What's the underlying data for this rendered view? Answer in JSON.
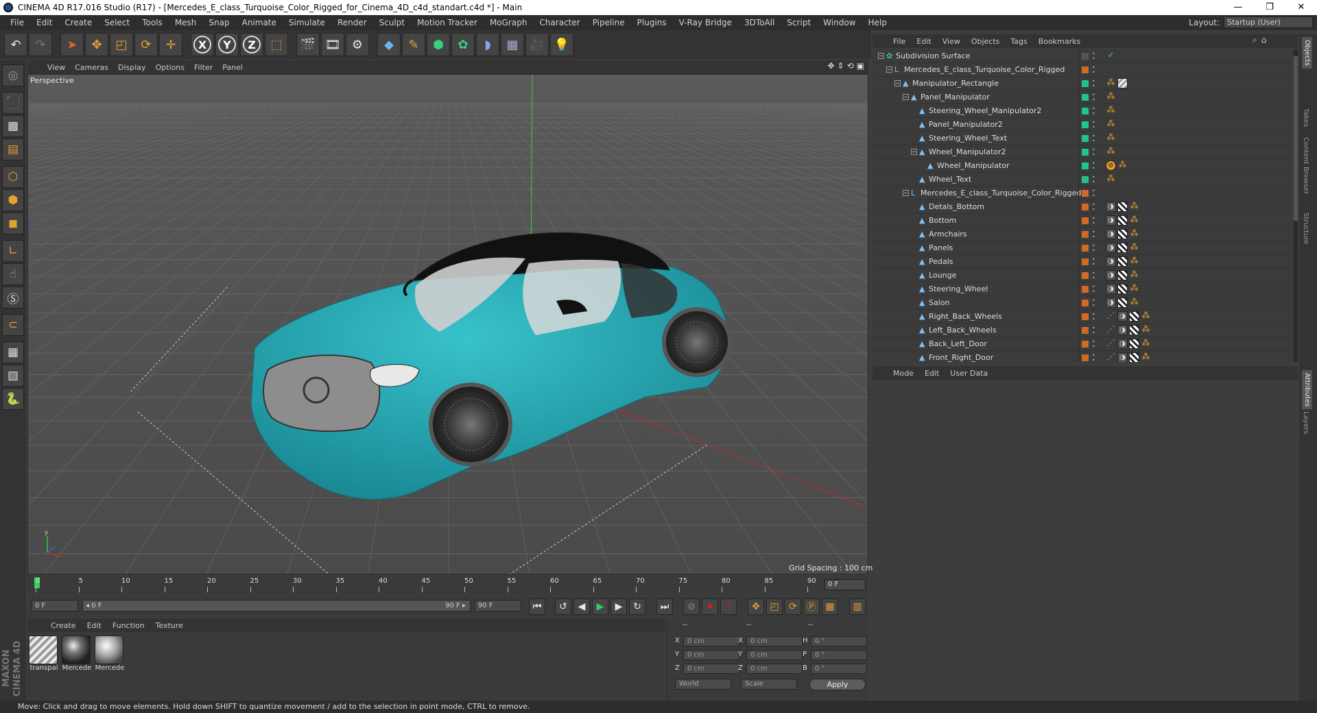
{
  "window": {
    "title": "CINEMA 4D R17.016 Studio (R17) - [Mercedes_E_class_Turquoise_Color_Rigged_for_Cinema_4D_c4d_standart.c4d *] - Main",
    "controls": [
      "—",
      "❐",
      "✕"
    ]
  },
  "menu": [
    "File",
    "Edit",
    "Create",
    "Select",
    "Tools",
    "Mesh",
    "Snap",
    "Animate",
    "Simulate",
    "Render",
    "Sculpt",
    "Motion Tracker",
    "MoGraph",
    "Character",
    "Pipeline",
    "Plugins",
    "V-Ray Bridge",
    "3DToAll",
    "Script",
    "Window",
    "Help"
  ],
  "layout": {
    "label": "Layout:",
    "value": "Startup (User)"
  },
  "viewport": {
    "menu": [
      "View",
      "Cameras",
      "Display",
      "Options",
      "Filter",
      "Panel"
    ],
    "label": "Perspective",
    "grid_spacing": "Grid Spacing : 100 cm"
  },
  "timeline": {
    "ticks": [
      "0",
      "5",
      "10",
      "15",
      "20",
      "25",
      "30",
      "35",
      "40",
      "45",
      "50",
      "55",
      "60",
      "65",
      "70",
      "75",
      "80",
      "85",
      "90"
    ],
    "frame_end_box": "0 F",
    "start_field": "0 F",
    "range_left": "◂ 0 F",
    "range_right": "90 F ▸",
    "end_field": "90 F"
  },
  "material_manager": {
    "menu": [
      "Create",
      "Edit",
      "Function",
      "Texture"
    ],
    "materials": [
      {
        "name": "transpai"
      },
      {
        "name": "Mercede"
      },
      {
        "name": "Mercede"
      }
    ]
  },
  "coordinates": {
    "headers": [
      "--",
      "--",
      "--"
    ],
    "rows": [
      {
        "a_label": "X",
        "a_value": "0 cm",
        "b_label": "X",
        "b_value": "0 cm",
        "c_label": "H",
        "c_value": "0 °"
      },
      {
        "a_label": "Y",
        "a_value": "0 cm",
        "b_label": "Y",
        "b_value": "0 cm",
        "c_label": "P",
        "c_value": "0 °"
      },
      {
        "a_label": "Z",
        "a_value": "0 cm",
        "b_label": "Z",
        "b_value": "0 cm",
        "c_label": "B",
        "c_value": "0 °"
      }
    ],
    "space": "World",
    "mode": "Scale",
    "apply": "Apply"
  },
  "object_manager": {
    "menu": [
      "File",
      "Edit",
      "View",
      "Objects",
      "Tags",
      "Bookmarks"
    ],
    "rows": [
      {
        "name": "Subdivision Surface",
        "depth": 0,
        "icon": "✿",
        "layer": "#555555",
        "tags": "check"
      },
      {
        "name": "Mercedes_E_class_Turquoise_Color_Rigged",
        "depth": 1,
        "icon": "L0",
        "layer": "#d06a2a",
        "tags": ""
      },
      {
        "name": "Manipulator_Rectangle",
        "depth": 2,
        "icon": "▲",
        "layer": "#22c48a",
        "tags": "dot-wt"
      },
      {
        "name": "Panel_Manipulator",
        "depth": 3,
        "icon": "▲",
        "layer": "#22c48a",
        "tags": "dot"
      },
      {
        "name": "Steering_Wheel_Manipulator2",
        "depth": 4,
        "icon": "▲",
        "layer": "#22c48a",
        "tags": "dot"
      },
      {
        "name": "Panel_Manipulator2",
        "depth": 4,
        "icon": "▲",
        "layer": "#22c48a",
        "tags": "dot"
      },
      {
        "name": "Steering_Wheel_Text",
        "depth": 4,
        "icon": "▲",
        "layer": "#22c48a",
        "tags": "dot"
      },
      {
        "name": "Wheel_Manipulator2",
        "depth": 4,
        "icon": "▲",
        "layer": "#22c48a",
        "tags": "dot"
      },
      {
        "name": "Wheel_Manipulator",
        "depth": 5,
        "icon": "▲",
        "layer": "#22c48a",
        "tags": "no-dot"
      },
      {
        "name": "Wheel_Text",
        "depth": 4,
        "icon": "▲",
        "layer": "#22c48a",
        "tags": "dot"
      },
      {
        "name": "Mercedes_E_class_Turquoise_Color_Riggedd",
        "depth": 3,
        "icon": "L0",
        "layer": "#d06a2a",
        "tags": ""
      },
      {
        "name": "Detals_Bottom",
        "depth": 4,
        "icon": "▲",
        "layer": "#d06a2a",
        "tags": "ph-chk-dot"
      },
      {
        "name": "Bottom",
        "depth": 4,
        "icon": "▲",
        "layer": "#d06a2a",
        "tags": "ph-chk-dot"
      },
      {
        "name": "Armchairs",
        "depth": 4,
        "icon": "▲",
        "layer": "#d06a2a",
        "tags": "ph-chk-dot"
      },
      {
        "name": "Panels",
        "depth": 4,
        "icon": "▲",
        "layer": "#d06a2a",
        "tags": "ph-chk-dot"
      },
      {
        "name": "Pedals",
        "depth": 4,
        "icon": "▲",
        "layer": "#d06a2a",
        "tags": "ph-chk-dot"
      },
      {
        "name": "Lounge",
        "depth": 4,
        "icon": "▲",
        "layer": "#d06a2a",
        "tags": "ph-chk-dot"
      },
      {
        "name": "Steering_Wheel",
        "depth": 4,
        "icon": "▲",
        "layer": "#d06a2a",
        "tags": "ph-chk-dot"
      },
      {
        "name": "Salon",
        "depth": 4,
        "icon": "▲",
        "layer": "#d06a2a",
        "tags": "ph-chk-dot"
      },
      {
        "name": "Right_Back_Wheels",
        "depth": 4,
        "icon": "▲",
        "layer": "#d06a2a",
        "tags": "sel-ph-chk-dot"
      },
      {
        "name": "Left_Back_Wheels",
        "depth": 4,
        "icon": "▲",
        "layer": "#d06a2a",
        "tags": "sel-ph-chk-dot"
      },
      {
        "name": "Back_Left_Door",
        "depth": 4,
        "icon": "▲",
        "layer": "#d06a2a",
        "tags": "sel-ph-chk-dot"
      },
      {
        "name": "Front_Right_Door",
        "depth": 4,
        "icon": "▲",
        "layer": "#d06a2a",
        "tags": "sel-ph-chk-dot"
      }
    ]
  },
  "attribute_manager": {
    "menu": [
      "Mode",
      "Edit",
      "User Data"
    ]
  },
  "right_tabs": [
    "Objects",
    "Takes",
    "Content Browser",
    "Structure",
    "Attributes",
    "Layers"
  ],
  "status": "Move: Click and drag to move elements. Hold down SHIFT to quantize movement / add to the selection in point mode, CTRL to remove.",
  "brand": "MAXON CINEMA 4D",
  "colors": {
    "accent": "#e8a030",
    "car": "#1f9faa",
    "play": "#2fd060",
    "record": "#d02020"
  }
}
